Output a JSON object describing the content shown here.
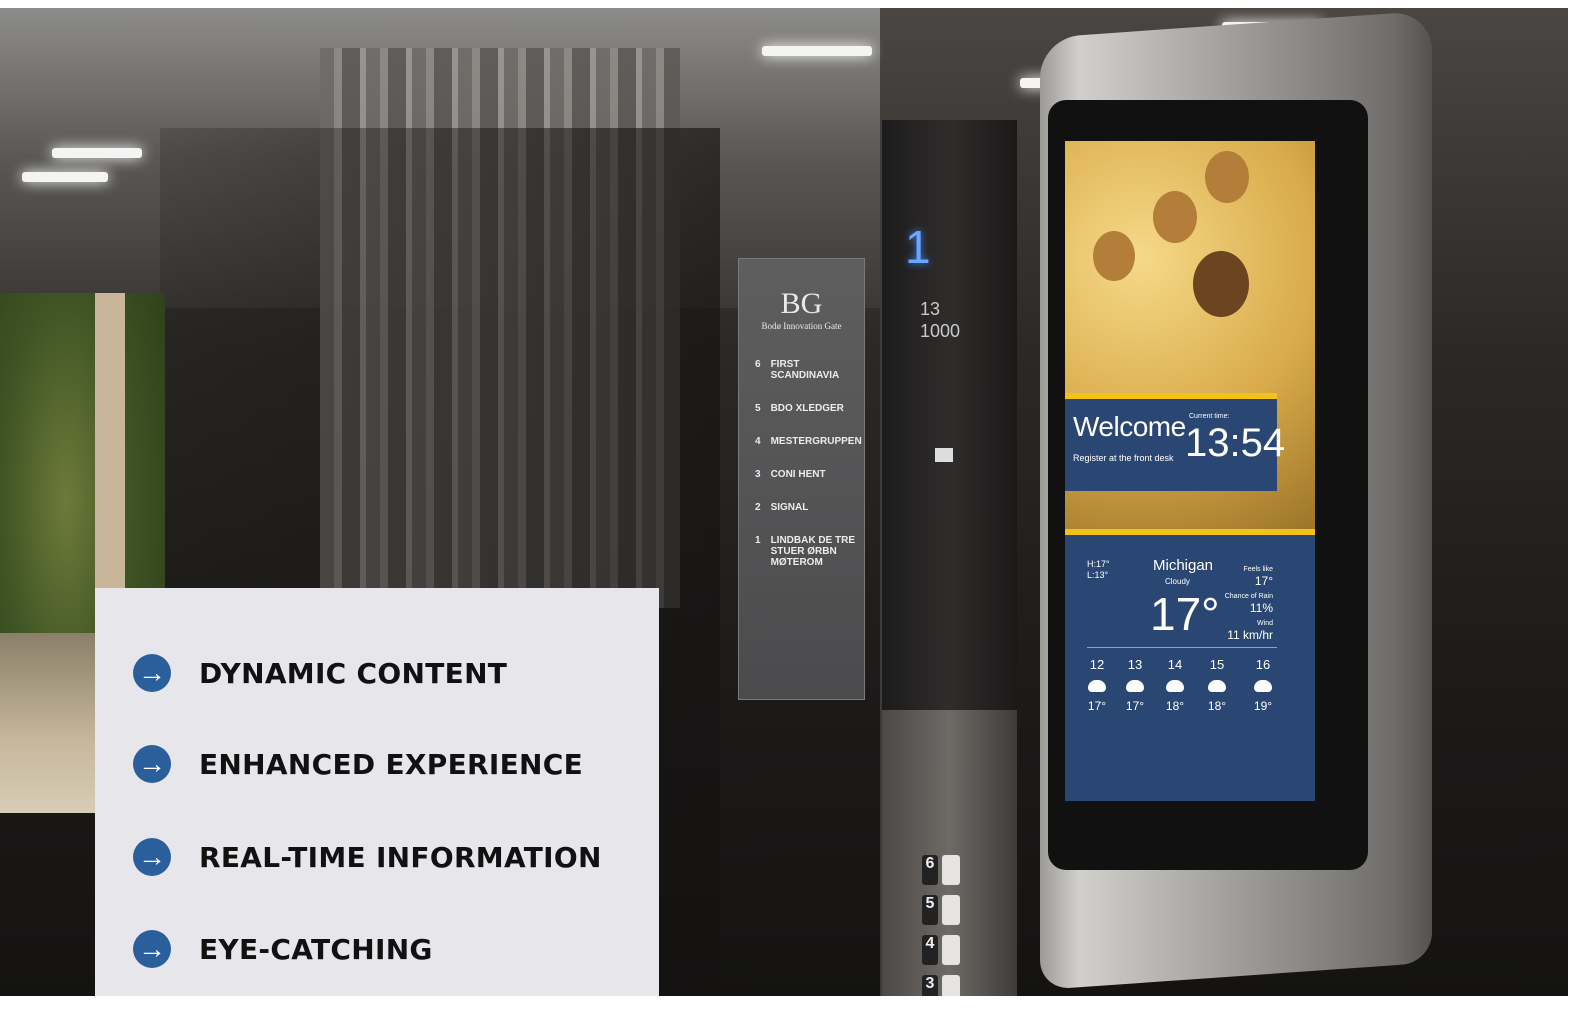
{
  "features": [
    {
      "label": "DYNAMIC CONTENT",
      "icon": "arrow-circle-icon"
    },
    {
      "label": "ENHANCED EXPERIENCE",
      "icon": "arrow-circle-icon"
    },
    {
      "label": "REAL-TIME INFORMATION",
      "icon": "arrow-circle-icon"
    },
    {
      "label": "EYE-CATCHING",
      "icon": "arrow-circle-icon"
    }
  ],
  "accent_color": "#2a5f9c",
  "screen": {
    "welcome_title": "Welcome",
    "welcome_sub": "Register at the front desk",
    "current_time_label": "Current time:",
    "time": "13:54",
    "weather": {
      "hi": "H:17°",
      "lo": "L:13°",
      "city": "Michigan",
      "condition": "Cloudy",
      "temp": "17°",
      "feels_label": "Feels like",
      "feels": "17°",
      "rain_label": "Chance of Rain",
      "rain": "11%",
      "wind_label": "Wind",
      "wind": "11 km/hr",
      "forecast": [
        {
          "hour": "12",
          "temp": "17°"
        },
        {
          "hour": "13",
          "temp": "17°"
        },
        {
          "hour": "14",
          "temp": "18°"
        },
        {
          "hour": "15",
          "temp": "18°"
        },
        {
          "hour": "16",
          "temp": "19°"
        }
      ]
    }
  },
  "elevator": {
    "floor_indicator": "1",
    "capacity_persons": "13",
    "capacity_kg": "1000",
    "buttons": [
      "6",
      "5",
      "4",
      "3"
    ]
  },
  "directory": {
    "logo": "BG",
    "logo_sub": "Bodø Innovation Gate",
    "entries": [
      {
        "floor": "6",
        "name": "FIRST SCANDINAVIA"
      },
      {
        "floor": "5",
        "name": "BDO XLEDGER"
      },
      {
        "floor": "4",
        "name": "MESTERGRUPPEN"
      },
      {
        "floor": "3",
        "name": "CONI HENT"
      },
      {
        "floor": "2",
        "name": "SIGNAL"
      },
      {
        "floor": "1",
        "name": "LINDBAK DE TRE STUER ØRBN MØTEROM"
      }
    ]
  }
}
